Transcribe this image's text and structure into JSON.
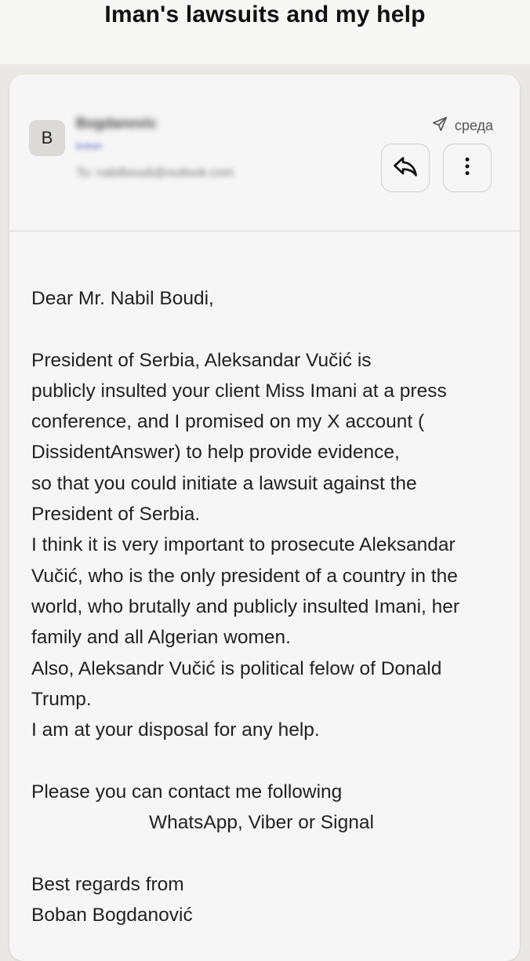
{
  "header": {
    "title": "Iman's lawsuits and my help"
  },
  "email": {
    "avatar_letter": "B",
    "sender_name": "Bogdanovic",
    "sender_email": "boban",
    "recipient": "To: nabilboudi@outlook.com",
    "sent_label": "среда",
    "greeting": "Dear Mr. Nabil Boudi,",
    "paragraph_lines": [
      "President of Serbia, Aleksandar Vučić is",
      "publicly insulted your client Miss Imani at a press",
      "conference, and I promised on my X account (",
      "DissidentAnswer) to help provide evidence,",
      "so that you could initiate a lawsuit against the",
      "President of Serbia.",
      "I think it is very important to prosecute Aleksandar",
      "Vučić, who is the only president of a country in the",
      "world, who brutally and publicly insulted Imani, her",
      "family and all Algerian women.",
      "Also, Aleksandr Vučić is political felow of Donald",
      "Trump.",
      "I am at your disposal for any help."
    ],
    "contact_line_1": "Please you can contact me following",
    "contact_line_2": "WhatsApp, Viber or Signal",
    "closing": "Best regards from",
    "signature": "Boban Bogdanović"
  }
}
